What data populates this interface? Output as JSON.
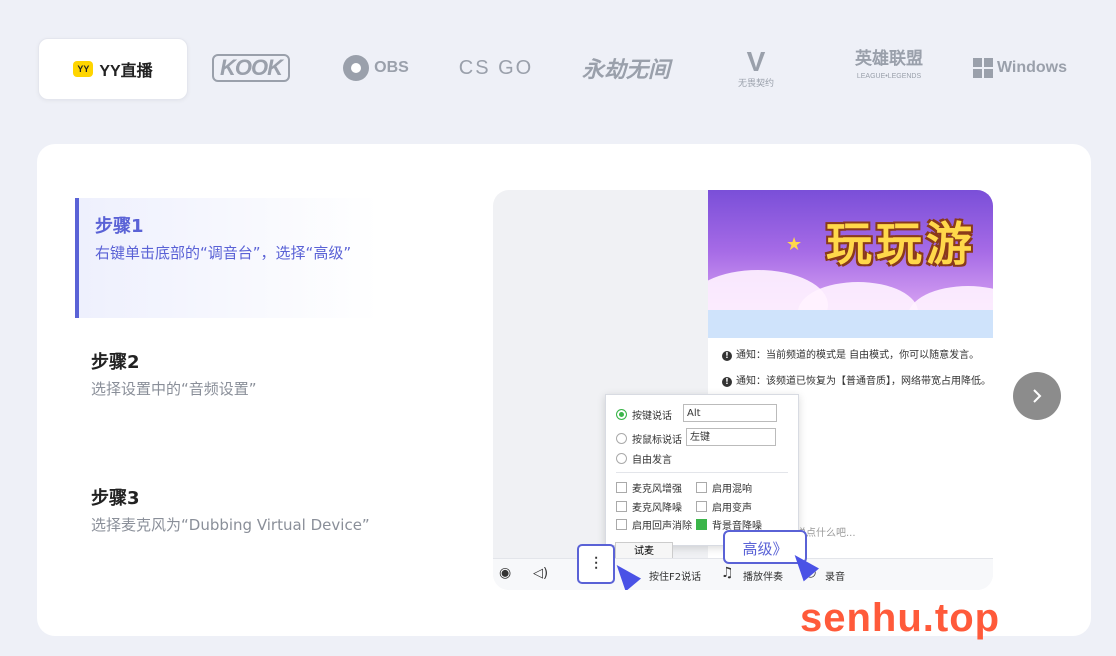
{
  "logos": {
    "yy": "YY直播",
    "yy_badge": "YY",
    "kook": "KOOK",
    "obs": "OBS",
    "csgo": "CS GO",
    "yongjie": "永劫无间",
    "valorant": "无畏契约",
    "lol": "英雄联盟",
    "lol_sub": "LEAGUE•LEGENDS",
    "windows": "Windows"
  },
  "steps": [
    {
      "title": "步骤1",
      "desc": "右键单击底部的“调音台”，选择“高级”"
    },
    {
      "title": "步骤2",
      "desc": "选择设置中的“音频设置”"
    },
    {
      "title": "步骤3",
      "desc": "选择麦克风为“Dubbing Virtual Device”"
    }
  ],
  "screenshot": {
    "banner_text": "玩玩游",
    "notice1": "通知：当前频道的模式是 自由模式，你可以随意发言。",
    "notice2": "通知：该频道已恢复为【普通音质】，网络带宽占用降低。",
    "say_placeholder": "说点什么吧...",
    "popup": {
      "ptt_key": "按键说话",
      "ptt_value": "Alt",
      "ptm": "按鼠标说话",
      "ptm_value": "左键",
      "free": "自由发言",
      "mic_boost": "麦克风增强",
      "reverb": "启用混响",
      "mic_denoise": "麦克风降噪",
      "voice_change": "启用变声",
      "echo_cancel": "启用回声消除",
      "bg_denoise": "背景音降噪",
      "try": "试麦"
    },
    "advanced": "高级》",
    "bottom": {
      "ptt_f2": "按住F2说话",
      "accompany": "播放伴奏",
      "record": "录音"
    }
  },
  "watermark": "senhu.top"
}
